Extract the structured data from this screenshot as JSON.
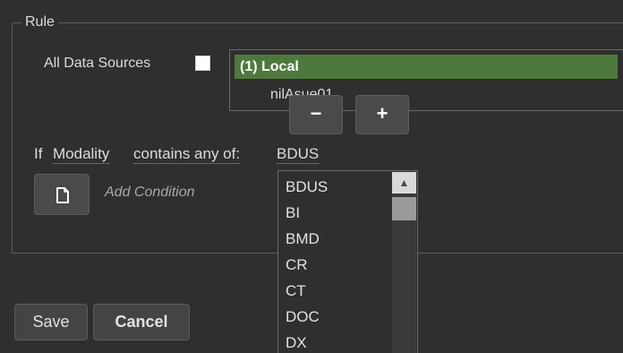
{
  "rule": {
    "legend": "Rule"
  },
  "data_sources": {
    "all_label": "All Data Sources",
    "all_checked": false,
    "items": [
      {
        "label": "(1)  Local",
        "selected": true
      },
      {
        "label": "nilAsue01",
        "selected": false
      }
    ],
    "remove_icon": "minus-icon",
    "add_icon": "plus-icon"
  },
  "condition": {
    "prefix": "If",
    "field": "Modality",
    "operator": "contains any of:",
    "value": "BDUS",
    "add_condition": "Add Condition"
  },
  "modality_options": [
    "BDUS",
    "BI",
    "BMD",
    "CR",
    "CT",
    "DOC",
    "DX"
  ],
  "actions": {
    "save": "Save",
    "cancel": "Cancel"
  },
  "colors": {
    "selected_bg": "#4d7a3c",
    "background": "#2f2f2f"
  }
}
